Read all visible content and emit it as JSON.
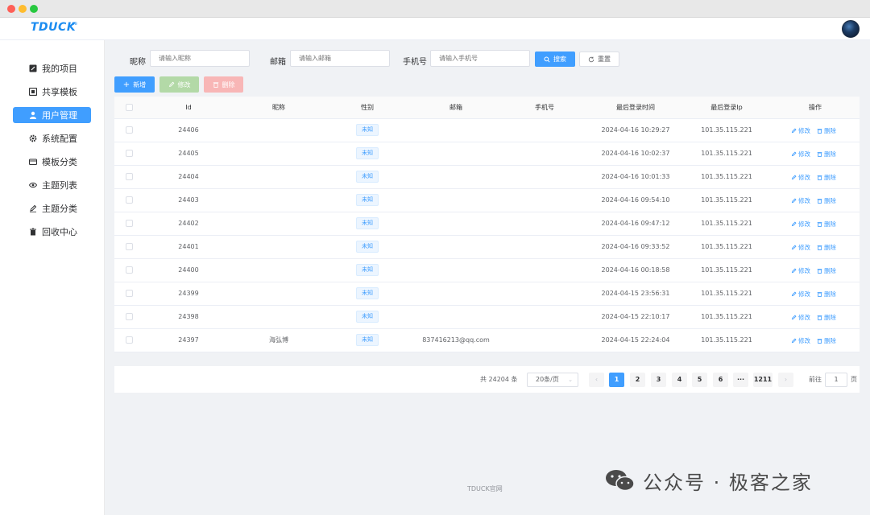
{
  "window": {
    "controls": [
      "close",
      "minimize",
      "maximize"
    ]
  },
  "header": {
    "logo": "TDUCK",
    "logo_sup": "ce"
  },
  "sidebar": {
    "items": [
      {
        "label": "我的项目",
        "icon": "edit-square-icon",
        "active": false
      },
      {
        "label": "共享模板",
        "icon": "share-template-icon",
        "active": false
      },
      {
        "label": "用户管理",
        "icon": "user-icon",
        "active": true
      },
      {
        "label": "系统配置",
        "icon": "gear-icon",
        "active": false
      },
      {
        "label": "模板分类",
        "icon": "card-icon",
        "active": false
      },
      {
        "label": "主题列表",
        "icon": "eye-icon",
        "active": false
      },
      {
        "label": "主题分类",
        "icon": "pen-icon",
        "active": false
      },
      {
        "label": "回收中心",
        "icon": "trash-icon",
        "active": false
      }
    ]
  },
  "search": {
    "nickname_label": "昵称",
    "nickname_placeholder": "请输入昵称",
    "email_label": "邮箱",
    "email_placeholder": "请输入邮箱",
    "phone_label": "手机号",
    "phone_placeholder": "请输入手机号",
    "search_button": "搜索",
    "reset_button": "重置"
  },
  "actions": {
    "add": "新增",
    "edit": "修改",
    "delete": "删除"
  },
  "table": {
    "headers": [
      "Id",
      "昵称",
      "性别",
      "邮箱",
      "手机号",
      "最后登录时间",
      "最后登录Ip",
      "操作"
    ],
    "row_edit": "修改",
    "row_delete": "删除",
    "rows": [
      {
        "id": "24406",
        "nickname": "",
        "gender": "未知",
        "email": "",
        "phone": "",
        "last_login": "2024-04-16 10:29:27",
        "ip": "101.35.115.221"
      },
      {
        "id": "24405",
        "nickname": "",
        "gender": "未知",
        "email": "",
        "phone": "",
        "last_login": "2024-04-16 10:02:37",
        "ip": "101.35.115.221"
      },
      {
        "id": "24404",
        "nickname": "",
        "gender": "未知",
        "email": "",
        "phone": "",
        "last_login": "2024-04-16 10:01:33",
        "ip": "101.35.115.221"
      },
      {
        "id": "24403",
        "nickname": "",
        "gender": "未知",
        "email": "",
        "phone": "",
        "last_login": "2024-04-16 09:54:10",
        "ip": "101.35.115.221"
      },
      {
        "id": "24402",
        "nickname": "",
        "gender": "未知",
        "email": "",
        "phone": "",
        "last_login": "2024-04-16 09:47:12",
        "ip": "101.35.115.221"
      },
      {
        "id": "24401",
        "nickname": "",
        "gender": "未知",
        "email": "",
        "phone": "",
        "last_login": "2024-04-16 09:33:52",
        "ip": "101.35.115.221"
      },
      {
        "id": "24400",
        "nickname": "",
        "gender": "未知",
        "email": "",
        "phone": "",
        "last_login": "2024-04-16 00:18:58",
        "ip": "101.35.115.221"
      },
      {
        "id": "24399",
        "nickname": "",
        "gender": "未知",
        "email": "",
        "phone": "",
        "last_login": "2024-04-15 23:56:31",
        "ip": "101.35.115.221"
      },
      {
        "id": "24398",
        "nickname": "",
        "gender": "未知",
        "email": "",
        "phone": "",
        "last_login": "2024-04-15 22:10:17",
        "ip": "101.35.115.221"
      },
      {
        "id": "24397",
        "nickname": "海弘博",
        "gender": "未知",
        "email": "837416213@qq.com",
        "phone": "",
        "last_login": "2024-04-15 22:24:04",
        "ip": "101.35.115.221"
      }
    ]
  },
  "pagination": {
    "total_text": "共 24204 条",
    "page_size": "20条/页",
    "pages": [
      "1",
      "2",
      "3",
      "4",
      "5",
      "6",
      "···",
      "1211"
    ],
    "current_page": "1",
    "goto_label": "前往",
    "goto_value": "1",
    "goto_suffix": "页"
  },
  "footer": {
    "text": "TDUCK官网"
  },
  "watermark": {
    "text": "公众号 · 极客之家"
  },
  "colors": {
    "primary": "#409eff",
    "success_light": "#b3d9a7",
    "danger_light": "#f8b6b6"
  }
}
